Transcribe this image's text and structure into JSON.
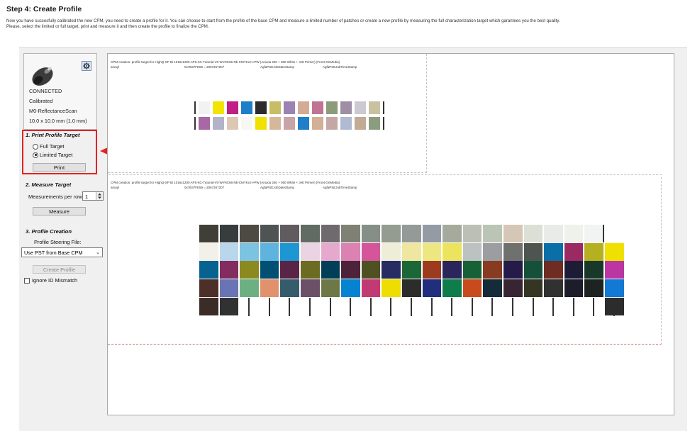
{
  "page": {
    "title": "Step 4: Create Profile",
    "description_line1": "Now you have succesfully calibrated the new CPM, you need to create a profile for it. You can choose to start from the profile of the base CPM and measure a limited number of patches or create a new profile by measuring the full characterization target which garantees you the best quality.",
    "description_line2": "Please, select the limited or full target, print and measure it and then create the profile to finalize the CPM."
  },
  "device": {
    "icon": "spectrophotometer-icon",
    "settings_icon": "gear-icon",
    "status_lines": [
      "CONNECTED",
      "Calibrated",
      "M0-ReflectanceScan",
      "10.0 x 10.0 mm (1.0 mm)"
    ]
  },
  "print_section": {
    "title": "1. Print Profile Target",
    "options": [
      {
        "label": "Full Target",
        "selected": false
      },
      {
        "label": "Limited Target",
        "selected": true
      }
    ],
    "print_button": "Print"
  },
  "measure_section": {
    "title": "2. Measure Target",
    "per_row_label": "Measurements per row",
    "per_row_value": "1",
    "measure_button": "Measure"
  },
  "profile_section": {
    "title": "3. Profile Creation",
    "steering_label": "Profile Steering File:",
    "steering_value": "Use PST from Base CPM",
    "create_button": "Create Profile",
    "ignore_label": "Ignore ID Mismatch"
  },
  "target_header": {
    "line1": "CPM creation: profile target for HighQ-SP Bi 1016x1200 APS-6C-Tutorial-V0-W-RIC66-Nb-CMYKcm+PW (Anuxia 250 + 050 White + Jett Primer) (Front-OnMedia)",
    "line2_left": "amayl",
    "line2_mid": "0x7B37FE59 = 2067267207",
    "line2_date": "AgfaPSEJobDateStamp",
    "line2_time": "AgfaPSEJobTimeStamp"
  },
  "colors": {
    "arrow": "#e32222",
    "highlight_border": "#e32222"
  },
  "limited_patches": {
    "row1": [
      "#f2f2f2",
      "#f2e400",
      "#c11f86",
      "#1d7fc8",
      "#2c2c2c",
      "#c7bd64",
      "#9b82b2",
      "#d4ab95",
      "#c07492",
      "#8c9b7a",
      "#9f8ea4",
      "#cdc9d2",
      "#c9c1a0"
    ],
    "row2": [
      "#a867a5",
      "#b4b2c8",
      "#dcc6b4",
      "#f7f7f4",
      "#f0e100",
      "#d7b79c",
      "#c8a4a8",
      "#1f7fc8",
      "#d2af95",
      "#c3a8a6",
      "#b1bad3",
      "#c2aa94",
      "#8c9d7f"
    ]
  },
  "full_patches": {
    "row1": [
      "#3f3f38",
      "#363d3c",
      "#4d4943",
      "#4e5454",
      "#605b5f",
      "#616b63",
      "#706a6e",
      "#7f8174",
      "#858f87",
      "#939c8f",
      "#949a97",
      "#949ba4",
      "#a4ab9c",
      "#bcbfb4",
      "#bbc5b5",
      "#d5c6b5",
      "#dcdfd6",
      "#e9ebe8",
      "#eef2eb",
      "#f2f3f3"
    ],
    "row2": [
      "#f3f0ea",
      "#b9d7ea",
      "#7cc2e2",
      "#5fb3df",
      "#1d97d3",
      "#ead3e3",
      "#e4a9cd",
      "#db82b3",
      "#d4559a",
      "#eeeed8",
      "#efe7a0",
      "#ede681",
      "#ede45d",
      "#bcc1c2",
      "#9c9da0",
      "#6f716f",
      "#4e5551",
      "#0a6ea7",
      "#9b2a63",
      "#b5b01f",
      "#efe001"
    ],
    "row3": [
      "#06628f",
      "#822c5f",
      "#8b8a20",
      "#014f73",
      "#5a2447",
      "#6b6c22",
      "#013f58",
      "#4c2339",
      "#505123",
      "#272c63",
      "#1b6737",
      "#9d3b1f",
      "#2a255a",
      "#176136",
      "#883b20",
      "#251b48",
      "#15513a",
      "#6f2c22",
      "#1d1c36",
      "#18392a",
      "#bc36a2"
    ],
    "row4": [
      "#4d2f2a",
      "#6974b4",
      "#6cb082",
      "#e1916c",
      "#345c6b",
      "#6c5068",
      "#6d7846",
      "#0484d0",
      "#c23a73",
      "#eddd00",
      "#2c2d2b",
      "#212d7d",
      "#0e7c4b",
      "#c84b1d",
      "#142b3a",
      "#382534",
      "#353524",
      "#313131",
      "#1d1c2a",
      "#1c2321",
      "#1279d4"
    ],
    "row5": [
      "#3a2d28",
      "#303232"
    ]
  }
}
